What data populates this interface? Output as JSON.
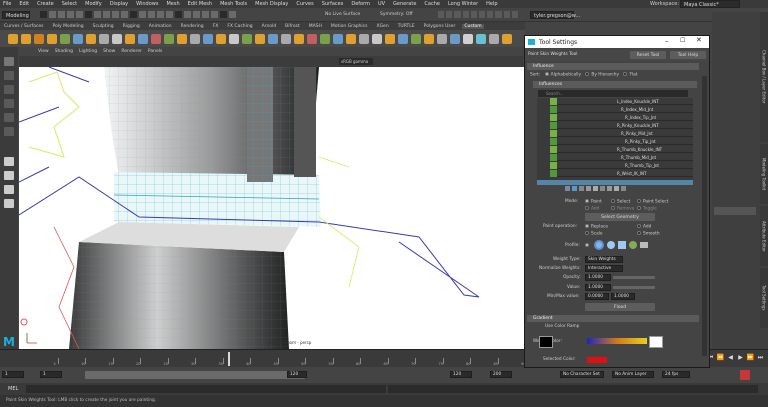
{
  "menubar": [
    "File",
    "Edit",
    "Create",
    "Select",
    "Modify",
    "Display",
    "Windows",
    "Mesh",
    "Edit Mesh",
    "Mesh Tools",
    "Mesh Display",
    "Curves",
    "Surfaces",
    "Deform",
    "UV",
    "Generate",
    "Cache",
    "Long Winter",
    "Help"
  ],
  "workspace": {
    "label": "Workspace:",
    "value": "Maya Classic*"
  },
  "status": {
    "mode": "Modeling",
    "live": "No Live Surface",
    "symmetry": "Symmetry: Off",
    "user": "tyler.gregson@w..."
  },
  "shelf_tabs": [
    "Curves / Surfaces",
    "Poly Modeling",
    "Sculpting",
    "Rigging",
    "Animation",
    "Rendering",
    "FX",
    "FX Caching",
    "Arnold",
    "Bifrost",
    "MASH",
    "Motion Graphics",
    "XGen",
    "TURTLE",
    "Polygons User",
    "Custom"
  ],
  "shelf_active": "Custom",
  "panel_menu": [
    "View",
    "Shading",
    "Lighting",
    "Show",
    "Renderer",
    "Panels"
  ],
  "viewport": {
    "gamma": "sRGB gamma",
    "camera_label": "2D Pan/Zoom - persp"
  },
  "tool_settings": {
    "title": "Tool Settings",
    "tool_name": "Paint Skin Weights Tool",
    "reset": "Reset Tool",
    "help": "Tool Help",
    "sort_label": "Sort:",
    "sort_options": [
      "Alphabetically",
      "By Hierarchy",
      "Flat"
    ],
    "influences_header": "Influence",
    "influences_sub": "Influences",
    "search_placeholder": "Search...",
    "influences": [
      "L_Index_Knuckle_INT",
      "R_Index_Mid_Jnt",
      "R_Index_Tip_Jnt",
      "R_Pinky_Knuckle_INT",
      "R_Pinky_Mid_Jnt",
      "R_Pinky_Tip_Jnt",
      "R_Thumb_Knuckle_INT",
      "R_Thumb_Mid_Jnt",
      "R_Thumb_Tip_Jnt",
      "R_Wrist_IK_INT"
    ],
    "influence_colors": [
      "#7ab04a",
      "#4f9a3c",
      "#7ab04a",
      "#4f9a3c",
      "#7ab04a",
      "#4f9a3c",
      "#7ab04a",
      "#4f9a3c",
      "#7ab04a",
      "#4f9a3c"
    ],
    "mode_label": "Mode:",
    "modes": [
      "Paint",
      "Select",
      "Paint Select"
    ],
    "select_options": [
      "Add",
      "Remove",
      "Toggle"
    ],
    "select_geometry": "Select Geometry",
    "paint_op_label": "Paint operation:",
    "paint_ops": [
      "Replace",
      "Add",
      "Scale",
      "Smooth"
    ],
    "profile_label": "Profile:",
    "weight_type_label": "Weight Type:",
    "weight_type": "Skin Weights",
    "normalize_label": "Normalize Weights:",
    "normalize": "Interactive",
    "opacity_label": "Opacity:",
    "opacity": "1.0000",
    "value_label": "Value:",
    "value": "1.0000",
    "minmax_label": "Min/Max value:",
    "min": "0.0000",
    "max": "1.0000",
    "flood": "Flood",
    "gradient_header": "Gradient",
    "use_color_ramp": "Use Color Ramp",
    "weight_color_label": "Weight Color:",
    "selected_color_label": "Selected Color:"
  },
  "timeline": {
    "ticks": [
      "5",
      "10",
      "15",
      "20",
      "25",
      "30",
      "35",
      "40",
      "45",
      "50",
      "55",
      "60",
      "65",
      "70",
      "75",
      "80",
      "85",
      "90",
      "95",
      "100",
      "105",
      "110",
      "115",
      "120"
    ],
    "current": "1"
  },
  "range": {
    "start": "1",
    "start2": "1",
    "end": "120",
    "end2": "120",
    "end3": "200",
    "char_set": "No Character Set",
    "anim_layer": "No Anim Layer",
    "fps": "24 fps"
  },
  "cmd": {
    "label": "MEL"
  },
  "help_text": "Paint Skin Weights Tool: LMB click to create the joint you are painting.",
  "right_panel": {
    "tabs": [
      "Channel Box / Layer Editor",
      "Modeling Toolkit",
      "Attribute Editor",
      "Tool Settings"
    ]
  }
}
